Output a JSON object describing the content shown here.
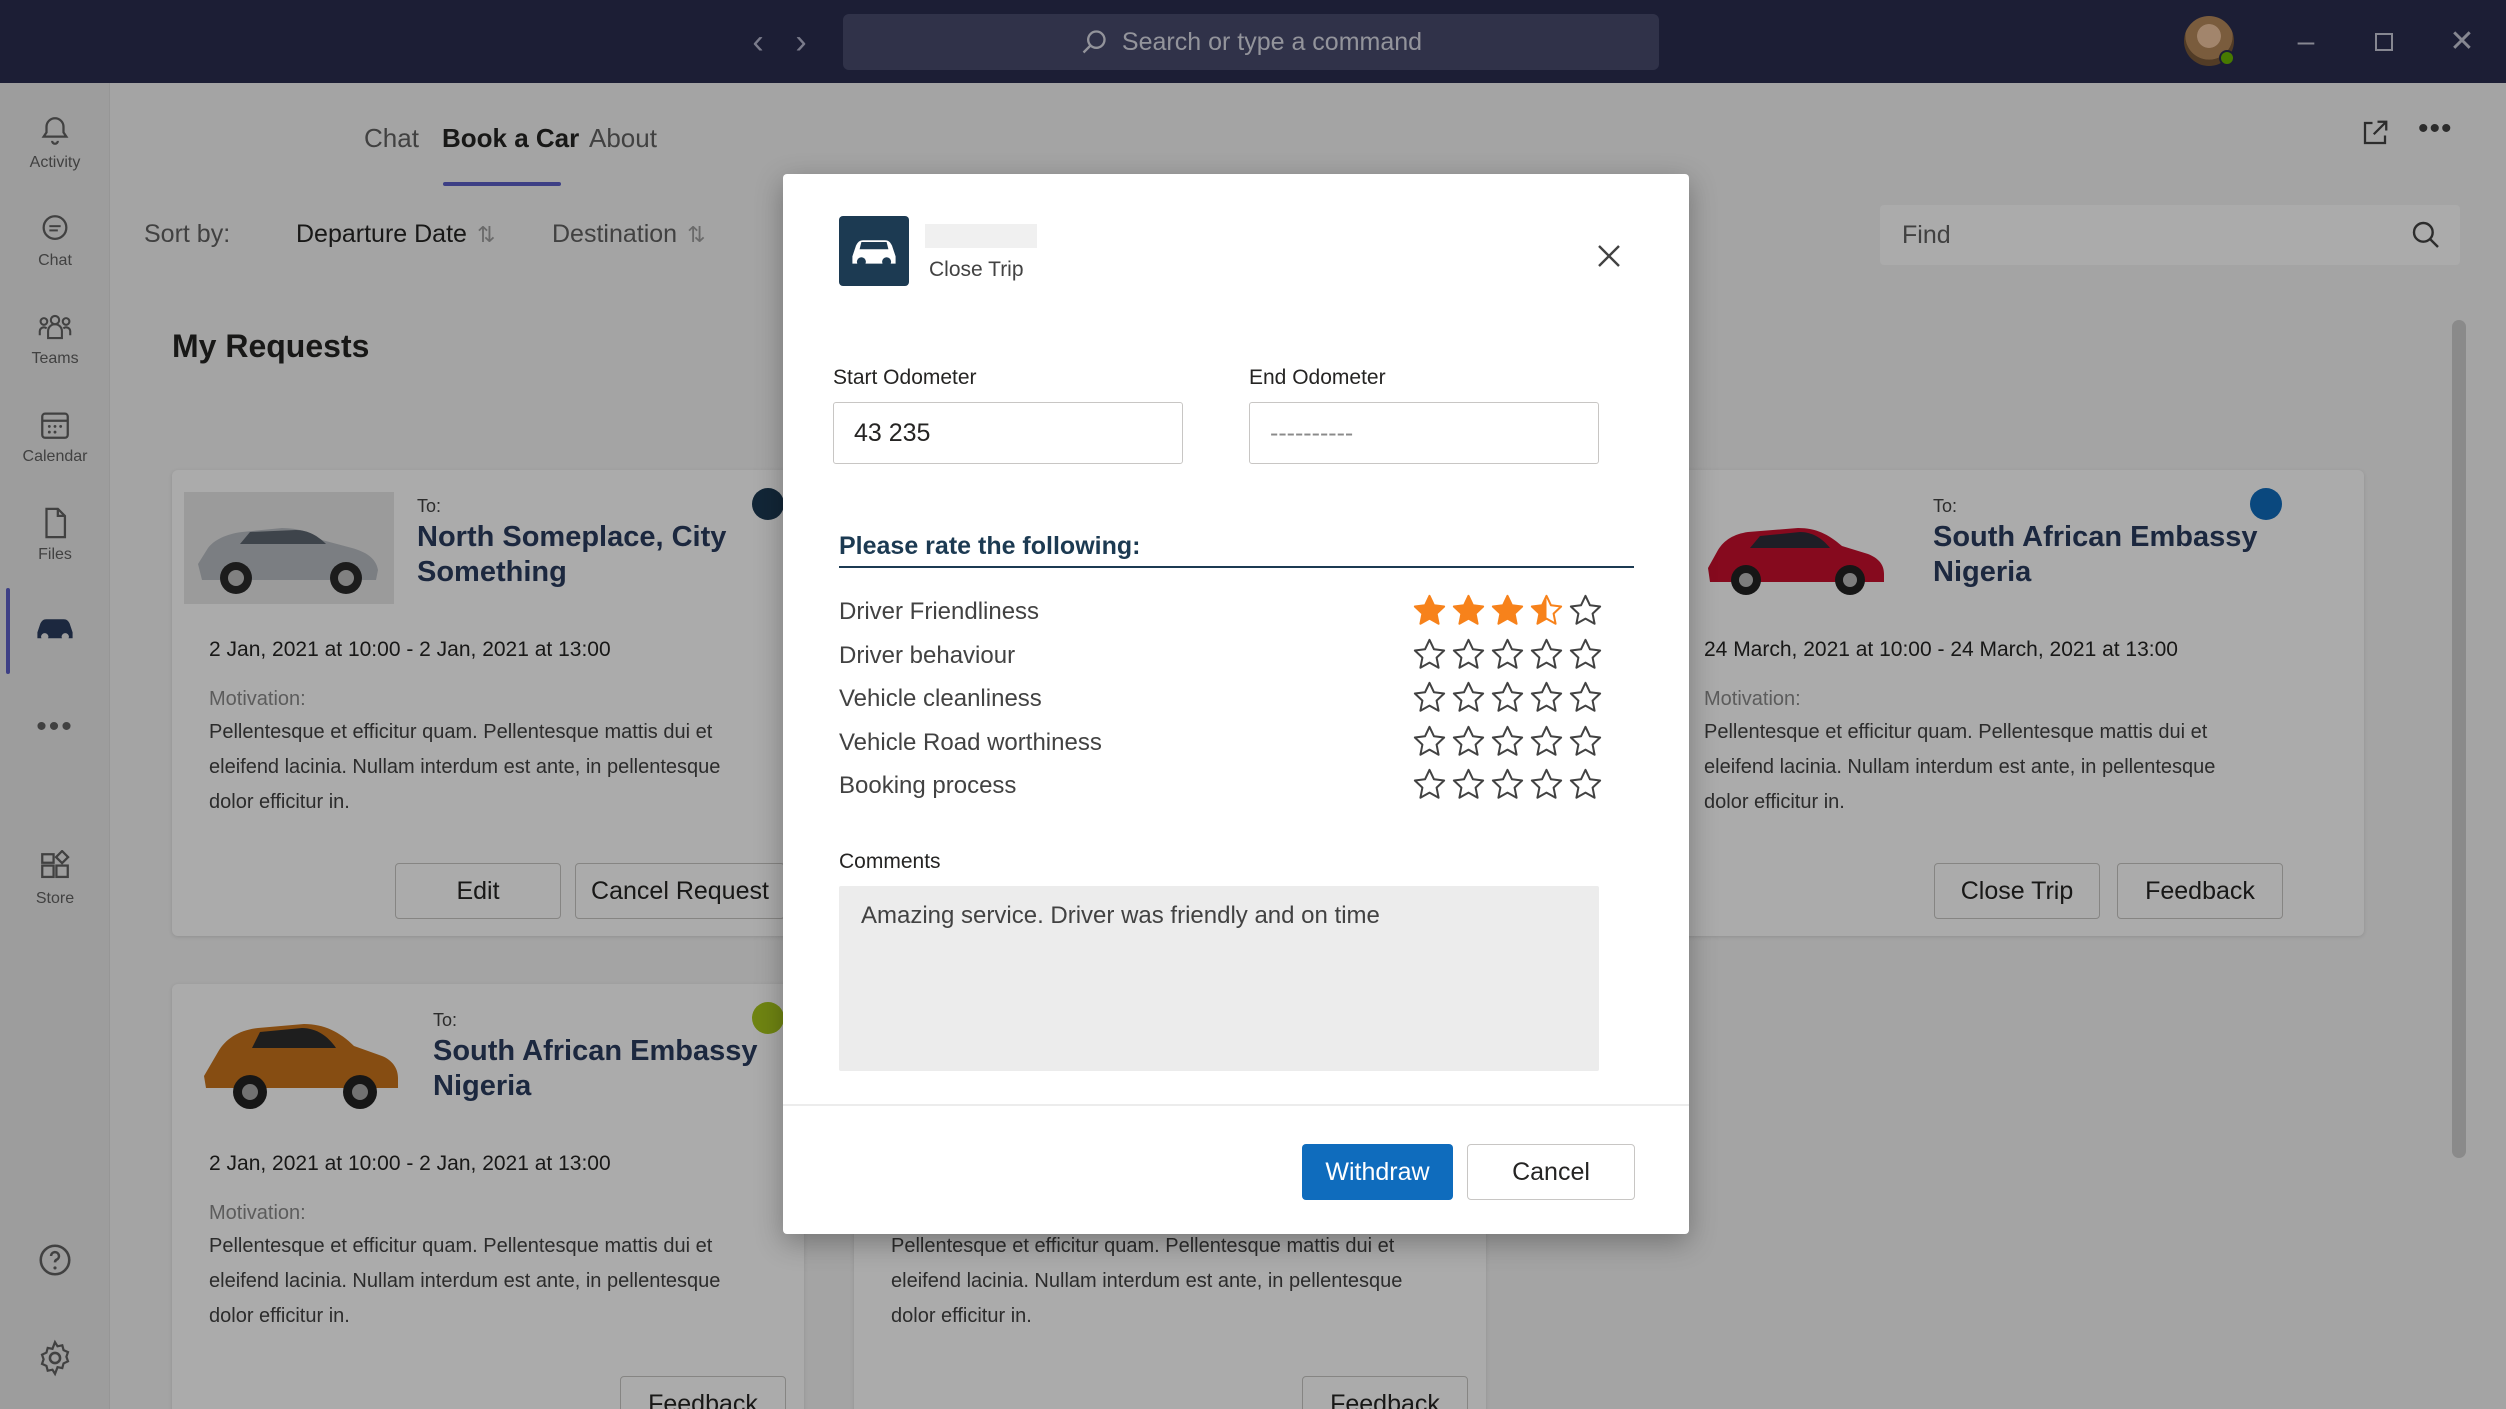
{
  "titlebar": {
    "search_placeholder": "Search or type a command",
    "back_icon": "chevron-left-icon",
    "forward_icon": "chevron-right-icon",
    "window_controls": [
      "minimize-icon",
      "maximize-icon",
      "close-icon"
    ]
  },
  "rail": {
    "items": [
      {
        "label": "Activity",
        "icon": "bell-icon"
      },
      {
        "label": "Chat",
        "icon": "chat-icon"
      },
      {
        "label": "Teams",
        "icon": "teams-icon"
      },
      {
        "label": "Calendar",
        "icon": "calendar-icon"
      },
      {
        "label": "Files",
        "icon": "file-icon"
      },
      {
        "label": "",
        "icon": "car-icon"
      },
      {
        "label": "",
        "icon": "more-icon"
      },
      {
        "label": "Store",
        "icon": "store-icon"
      }
    ],
    "help_icon": "help-icon",
    "settings_icon": "gear-icon"
  },
  "header": {
    "tabs": [
      {
        "label": "Chat"
      },
      {
        "label": "Book a Car",
        "active": true
      },
      {
        "label": "About"
      }
    ]
  },
  "toolbar": {
    "sort_label": "Sort by:",
    "sort_departure": "Departure Date",
    "sort_destination": "Destination",
    "find_placeholder": "Find"
  },
  "main": {
    "section_title": "My Requests",
    "cards": [
      {
        "to_label": "To:",
        "destination": "North Someplace, City Something",
        "dates": "2 Jan, 2021 at 10:00 - 2 Jan, 2021 at 13:00",
        "motivation_label": "Motivation:",
        "motivation": "Pellentesque et efficitur quam. Pellentesque mattis dui et eleifend lacinia. Nullam interdum est ante, in pellentesque dolor efficitur in.",
        "buttons": [
          "Edit",
          "Cancel Request"
        ],
        "dot_color": "#1c3a52"
      },
      {
        "to_label": "To:",
        "destination": "South African Embassy Nigeria",
        "dates": "24 March, 2021 at 10:00 - 24 March, 2021 at 13:00",
        "motivation_label": "Motivation:",
        "motivation": "Pellentesque et efficitur quam. Pellentesque mattis dui et eleifend lacinia. Nullam interdum est ante, in pellentesque dolor efficitur in.",
        "buttons": [
          "Close Trip",
          "Feedback"
        ],
        "dot_color": "#0f6cbd"
      },
      {
        "to_label": "To:",
        "destination": "South African Embassy Nigeria",
        "dates": "2 Jan, 2021 at 10:00 - 2 Jan, 2021 at 13:00",
        "motivation_label": "Motivation:",
        "motivation": "Pellentesque et efficitur quam. Pellentesque mattis dui et eleifend lacinia. Nullam interdum est ante, in pellentesque dolor efficitur in.",
        "buttons": [
          "Feedback"
        ],
        "dot_color": "#a6c51b"
      },
      {
        "motivation": "Pellentesque et efficitur quam. Pellentesque mattis dui et eleifend lacinia. Nullam interdum est ante, in pellentesque dolor efficitur in.",
        "buttons": [
          "Feedback"
        ]
      }
    ]
  },
  "dialog": {
    "subtitle": "Close Trip",
    "icon": "car-icon",
    "start_odometer_label": "Start Odometer",
    "start_odometer_value": "43 235",
    "end_odometer_label": "End Odometer",
    "end_odometer_placeholder": "----------",
    "rate_title": "Please rate the following:",
    "ratings": [
      {
        "label": "Driver Friendliness",
        "value": 3.5,
        "max": 5
      },
      {
        "label": "Driver behaviour",
        "value": 0,
        "max": 5
      },
      {
        "label": "Vehicle cleanliness",
        "value": 0,
        "max": 5
      },
      {
        "label": "Vehicle Road worthiness",
        "value": 0,
        "max": 5
      },
      {
        "label": "Booking process",
        "value": 0,
        "max": 5
      }
    ],
    "comments_label": "Comments",
    "comments_value": "Amazing service. Driver was friendly and on time",
    "primary_button": "Withdraw",
    "secondary_button": "Cancel"
  },
  "colors": {
    "titlebar": "#2a2d4f",
    "accent": "#5b5fc7",
    "primary_button": "#0f6cbd",
    "star_fill": "#f7821b",
    "dialog_heading": "#1c3a52"
  }
}
